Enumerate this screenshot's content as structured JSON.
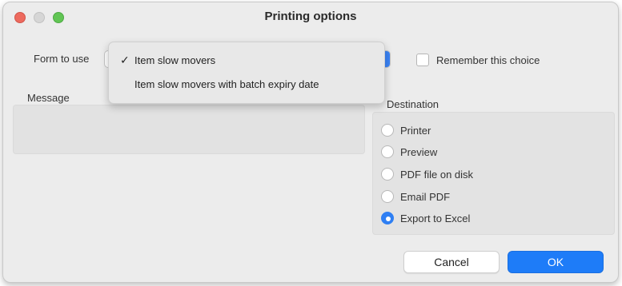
{
  "window": {
    "title": "Printing options"
  },
  "form": {
    "label": "Form to use",
    "options": [
      {
        "label": "Item slow movers",
        "checked": true
      },
      {
        "label": "Item slow movers with batch expiry date",
        "checked": false
      }
    ],
    "check_glyph": "✓"
  },
  "remember": {
    "label": "Remember this choice",
    "checked": false
  },
  "message": {
    "label": "Message",
    "value": ""
  },
  "destination": {
    "label": "Destination",
    "options": [
      {
        "label": "Printer",
        "selected": false
      },
      {
        "label": "Preview",
        "selected": false
      },
      {
        "label": "PDF file on disk",
        "selected": false
      },
      {
        "label": "Email PDF",
        "selected": false
      },
      {
        "label": "Export to Excel",
        "selected": true
      }
    ]
  },
  "buttons": {
    "cancel": "Cancel",
    "ok": "OK"
  },
  "colors": {
    "accent": "#1e7cf8",
    "close": "#ed6a5e",
    "minimize": "#d6d6d6",
    "maximize": "#61c554"
  }
}
